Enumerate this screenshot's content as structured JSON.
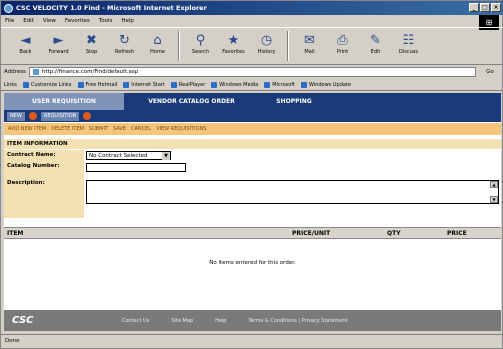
{
  "window": {
    "title": "CSC VELOCITY 1.0 Find - Microsoft Internet Explorer",
    "min": "_",
    "max": "□",
    "close": "×"
  },
  "menu": [
    "File",
    "Edit",
    "View",
    "Favorites",
    "Tools",
    "Help"
  ],
  "toolbar": [
    {
      "label": "Back",
      "icon": "◄"
    },
    {
      "label": "Forward",
      "icon": "►"
    },
    {
      "label": "Stop",
      "icon": "✖"
    },
    {
      "label": "Refresh",
      "icon": "↻"
    },
    {
      "label": "Home",
      "icon": "⌂"
    },
    {
      "label": "Search",
      "icon": "⚲"
    },
    {
      "label": "Favorites",
      "icon": "★"
    },
    {
      "label": "History",
      "icon": "◷"
    },
    {
      "label": "Mail",
      "icon": "✉"
    },
    {
      "label": "Print",
      "icon": "⎙"
    },
    {
      "label": "Edit",
      "icon": "✎"
    },
    {
      "label": "Discuss",
      "icon": "☷"
    }
  ],
  "address": {
    "label": "Address",
    "url": "http://finance.com/Find/default.asp",
    "go": "Go",
    "links": "Links"
  },
  "links": [
    "Customize Links",
    "Free Hotmail",
    "Internet Start",
    "RealPlayer",
    "Windows Media",
    "Microsoft",
    "Windows Update"
  ],
  "tabs": [
    "USER REQUISITION",
    "VENDOR CATALOG ORDER",
    "SHOPPING"
  ],
  "subbar": [
    "NEW",
    "REQUISITION"
  ],
  "orangebar": [
    "ADD NEW ITEM",
    "DELETE ITEM",
    "SUBMIT",
    "SAVE",
    "CANCEL",
    "VIEW REQUISITIONS"
  ],
  "section_title": "ITEM INFORMATION",
  "form": {
    "contract_label": "Contract Name:",
    "contract_value": "No Contract Selected",
    "catalog_label": "Catalog Number:",
    "catalog_value": "",
    "description_label": "Description:",
    "description_value": ""
  },
  "grid": {
    "columns": [
      "ITEM",
      "PRICE/UNIT",
      "QTY",
      "PRICE"
    ],
    "empty": "No items entered for this order."
  },
  "footer": {
    "logo": "CSC",
    "links": [
      "Contact Us",
      "Site Map",
      "Help",
      "Terms & Conditions | Privacy Statement"
    ]
  },
  "status": "Done"
}
